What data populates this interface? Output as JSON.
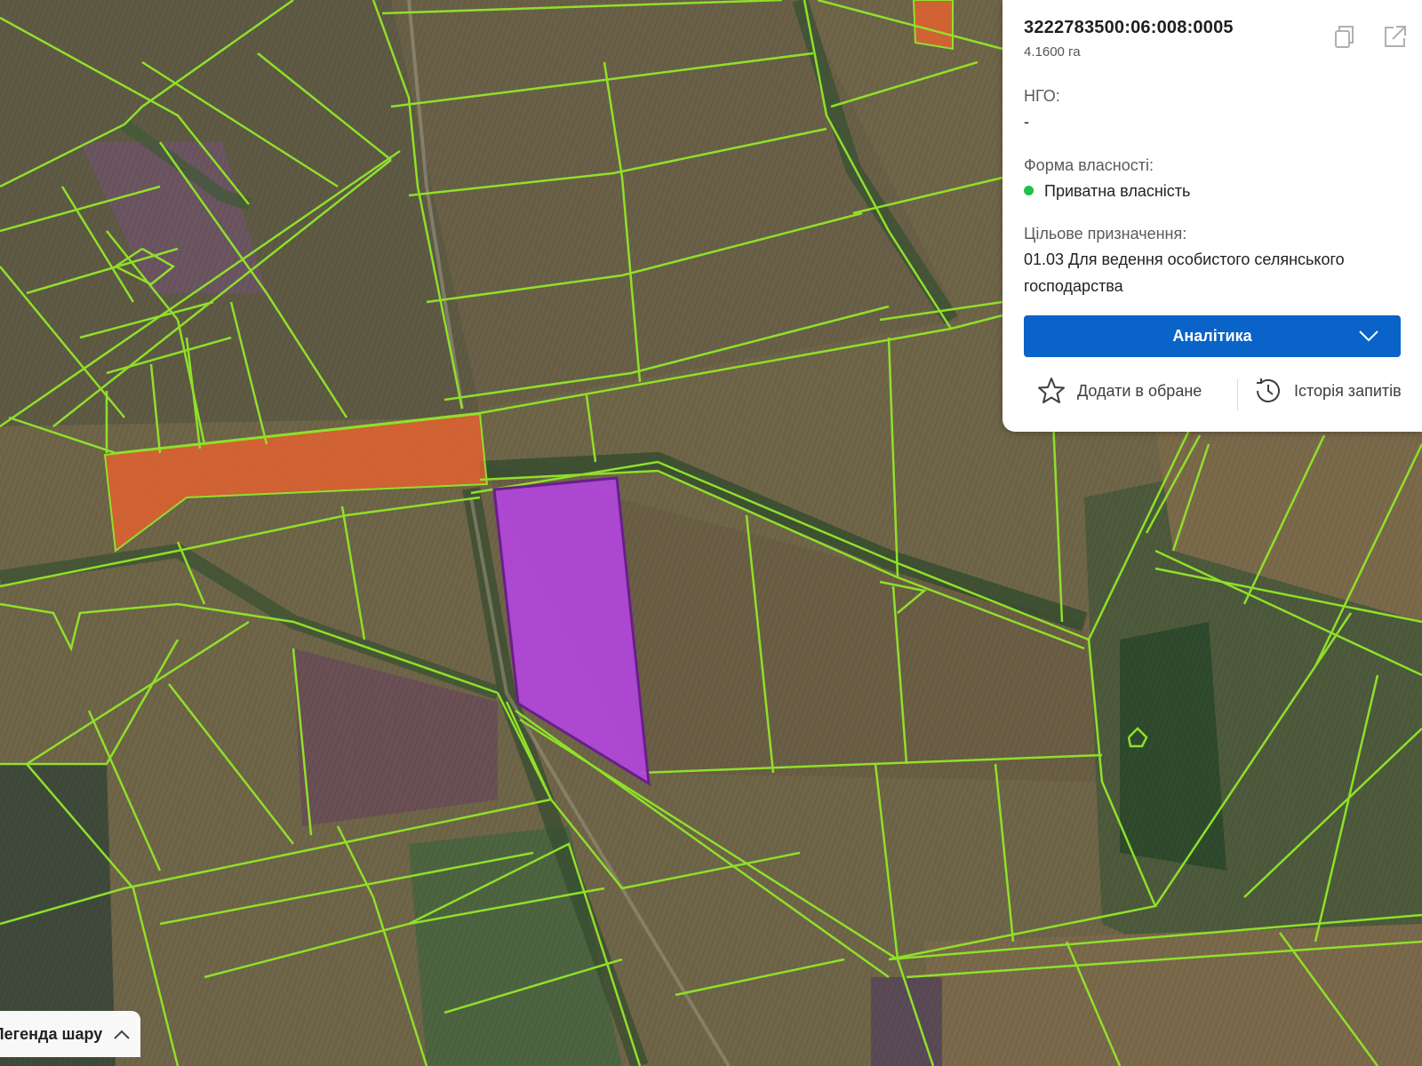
{
  "parcel": {
    "cadastral_number": "3222783500:06:008:0005",
    "area": "4.1600 га"
  },
  "fields": {
    "ngo_label": "НГО:",
    "ngo_value": "-",
    "ownership_label": "Форма власності:",
    "ownership_value": "Приватна власність",
    "ownership_color": "#22c04a",
    "purpose_label": "Цільове призначення:",
    "purpose_value": "01.03 Для ведення особистого селянського господарства"
  },
  "actions": {
    "analytics_label": "Аналітика",
    "favorite_label": "Додати в обране",
    "history_label": "Історія запитів"
  },
  "icons": [
    "copy-icon",
    "external-link-icon",
    "chevron-down-icon",
    "star-icon",
    "history-icon",
    "chevron-up-icon"
  ],
  "legend": {
    "label": "Легенда шару"
  },
  "colors": {
    "parcel_border": "#8fe02a",
    "selected_parcel": "#b445e0",
    "highlight_parcel": "#e8612f",
    "primary_button": "#0a63c9"
  }
}
